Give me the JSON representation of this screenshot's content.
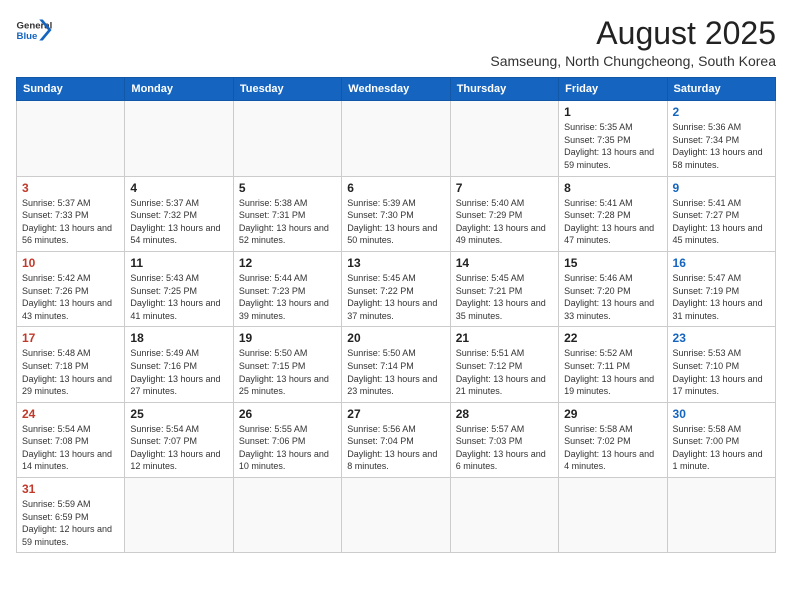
{
  "header": {
    "logo_general": "General",
    "logo_blue": "Blue",
    "month_year": "August 2025",
    "location": "Samseung, North Chungcheong, South Korea"
  },
  "weekdays": [
    "Sunday",
    "Monday",
    "Tuesday",
    "Wednesday",
    "Thursday",
    "Friday",
    "Saturday"
  ],
  "weeks": [
    [
      {
        "day": "",
        "info": ""
      },
      {
        "day": "",
        "info": ""
      },
      {
        "day": "",
        "info": ""
      },
      {
        "day": "",
        "info": ""
      },
      {
        "day": "",
        "info": ""
      },
      {
        "day": "1",
        "info": "Sunrise: 5:35 AM\nSunset: 7:35 PM\nDaylight: 13 hours and 59 minutes."
      },
      {
        "day": "2",
        "info": "Sunrise: 5:36 AM\nSunset: 7:34 PM\nDaylight: 13 hours and 58 minutes."
      }
    ],
    [
      {
        "day": "3",
        "info": "Sunrise: 5:37 AM\nSunset: 7:33 PM\nDaylight: 13 hours and 56 minutes."
      },
      {
        "day": "4",
        "info": "Sunrise: 5:37 AM\nSunset: 7:32 PM\nDaylight: 13 hours and 54 minutes."
      },
      {
        "day": "5",
        "info": "Sunrise: 5:38 AM\nSunset: 7:31 PM\nDaylight: 13 hours and 52 minutes."
      },
      {
        "day": "6",
        "info": "Sunrise: 5:39 AM\nSunset: 7:30 PM\nDaylight: 13 hours and 50 minutes."
      },
      {
        "day": "7",
        "info": "Sunrise: 5:40 AM\nSunset: 7:29 PM\nDaylight: 13 hours and 49 minutes."
      },
      {
        "day": "8",
        "info": "Sunrise: 5:41 AM\nSunset: 7:28 PM\nDaylight: 13 hours and 47 minutes."
      },
      {
        "day": "9",
        "info": "Sunrise: 5:41 AM\nSunset: 7:27 PM\nDaylight: 13 hours and 45 minutes."
      }
    ],
    [
      {
        "day": "10",
        "info": "Sunrise: 5:42 AM\nSunset: 7:26 PM\nDaylight: 13 hours and 43 minutes."
      },
      {
        "day": "11",
        "info": "Sunrise: 5:43 AM\nSunset: 7:25 PM\nDaylight: 13 hours and 41 minutes."
      },
      {
        "day": "12",
        "info": "Sunrise: 5:44 AM\nSunset: 7:23 PM\nDaylight: 13 hours and 39 minutes."
      },
      {
        "day": "13",
        "info": "Sunrise: 5:45 AM\nSunset: 7:22 PM\nDaylight: 13 hours and 37 minutes."
      },
      {
        "day": "14",
        "info": "Sunrise: 5:45 AM\nSunset: 7:21 PM\nDaylight: 13 hours and 35 minutes."
      },
      {
        "day": "15",
        "info": "Sunrise: 5:46 AM\nSunset: 7:20 PM\nDaylight: 13 hours and 33 minutes."
      },
      {
        "day": "16",
        "info": "Sunrise: 5:47 AM\nSunset: 7:19 PM\nDaylight: 13 hours and 31 minutes."
      }
    ],
    [
      {
        "day": "17",
        "info": "Sunrise: 5:48 AM\nSunset: 7:18 PM\nDaylight: 13 hours and 29 minutes."
      },
      {
        "day": "18",
        "info": "Sunrise: 5:49 AM\nSunset: 7:16 PM\nDaylight: 13 hours and 27 minutes."
      },
      {
        "day": "19",
        "info": "Sunrise: 5:50 AM\nSunset: 7:15 PM\nDaylight: 13 hours and 25 minutes."
      },
      {
        "day": "20",
        "info": "Sunrise: 5:50 AM\nSunset: 7:14 PM\nDaylight: 13 hours and 23 minutes."
      },
      {
        "day": "21",
        "info": "Sunrise: 5:51 AM\nSunset: 7:12 PM\nDaylight: 13 hours and 21 minutes."
      },
      {
        "day": "22",
        "info": "Sunrise: 5:52 AM\nSunset: 7:11 PM\nDaylight: 13 hours and 19 minutes."
      },
      {
        "day": "23",
        "info": "Sunrise: 5:53 AM\nSunset: 7:10 PM\nDaylight: 13 hours and 17 minutes."
      }
    ],
    [
      {
        "day": "24",
        "info": "Sunrise: 5:54 AM\nSunset: 7:08 PM\nDaylight: 13 hours and 14 minutes."
      },
      {
        "day": "25",
        "info": "Sunrise: 5:54 AM\nSunset: 7:07 PM\nDaylight: 13 hours and 12 minutes."
      },
      {
        "day": "26",
        "info": "Sunrise: 5:55 AM\nSunset: 7:06 PM\nDaylight: 13 hours and 10 minutes."
      },
      {
        "day": "27",
        "info": "Sunrise: 5:56 AM\nSunset: 7:04 PM\nDaylight: 13 hours and 8 minutes."
      },
      {
        "day": "28",
        "info": "Sunrise: 5:57 AM\nSunset: 7:03 PM\nDaylight: 13 hours and 6 minutes."
      },
      {
        "day": "29",
        "info": "Sunrise: 5:58 AM\nSunset: 7:02 PM\nDaylight: 13 hours and 4 minutes."
      },
      {
        "day": "30",
        "info": "Sunrise: 5:58 AM\nSunset: 7:00 PM\nDaylight: 13 hours and 1 minute."
      }
    ],
    [
      {
        "day": "31",
        "info": "Sunrise: 5:59 AM\nSunset: 6:59 PM\nDaylight: 12 hours and 59 minutes."
      },
      {
        "day": "",
        "info": ""
      },
      {
        "day": "",
        "info": ""
      },
      {
        "day": "",
        "info": ""
      },
      {
        "day": "",
        "info": ""
      },
      {
        "day": "",
        "info": ""
      },
      {
        "day": "",
        "info": ""
      }
    ]
  ]
}
